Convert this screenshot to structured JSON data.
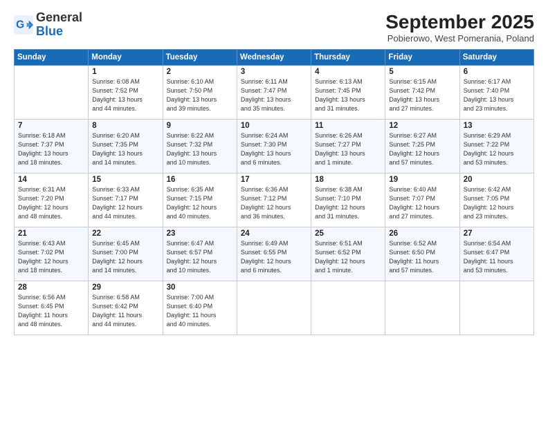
{
  "logo": {
    "general": "General",
    "blue": "Blue"
  },
  "header": {
    "month": "September 2025",
    "location": "Pobierowo, West Pomerania, Poland"
  },
  "days_of_week": [
    "Sunday",
    "Monday",
    "Tuesday",
    "Wednesday",
    "Thursday",
    "Friday",
    "Saturday"
  ],
  "weeks": [
    [
      {
        "day": "",
        "info": ""
      },
      {
        "day": "1",
        "info": "Sunrise: 6:08 AM\nSunset: 7:52 PM\nDaylight: 13 hours\nand 44 minutes."
      },
      {
        "day": "2",
        "info": "Sunrise: 6:10 AM\nSunset: 7:50 PM\nDaylight: 13 hours\nand 39 minutes."
      },
      {
        "day": "3",
        "info": "Sunrise: 6:11 AM\nSunset: 7:47 PM\nDaylight: 13 hours\nand 35 minutes."
      },
      {
        "day": "4",
        "info": "Sunrise: 6:13 AM\nSunset: 7:45 PM\nDaylight: 13 hours\nand 31 minutes."
      },
      {
        "day": "5",
        "info": "Sunrise: 6:15 AM\nSunset: 7:42 PM\nDaylight: 13 hours\nand 27 minutes."
      },
      {
        "day": "6",
        "info": "Sunrise: 6:17 AM\nSunset: 7:40 PM\nDaylight: 13 hours\nand 23 minutes."
      }
    ],
    [
      {
        "day": "7",
        "info": "Sunrise: 6:18 AM\nSunset: 7:37 PM\nDaylight: 13 hours\nand 18 minutes."
      },
      {
        "day": "8",
        "info": "Sunrise: 6:20 AM\nSunset: 7:35 PM\nDaylight: 13 hours\nand 14 minutes."
      },
      {
        "day": "9",
        "info": "Sunrise: 6:22 AM\nSunset: 7:32 PM\nDaylight: 13 hours\nand 10 minutes."
      },
      {
        "day": "10",
        "info": "Sunrise: 6:24 AM\nSunset: 7:30 PM\nDaylight: 13 hours\nand 6 minutes."
      },
      {
        "day": "11",
        "info": "Sunrise: 6:26 AM\nSunset: 7:27 PM\nDaylight: 13 hours\nand 1 minute."
      },
      {
        "day": "12",
        "info": "Sunrise: 6:27 AM\nSunset: 7:25 PM\nDaylight: 12 hours\nand 57 minutes."
      },
      {
        "day": "13",
        "info": "Sunrise: 6:29 AM\nSunset: 7:22 PM\nDaylight: 12 hours\nand 53 minutes."
      }
    ],
    [
      {
        "day": "14",
        "info": "Sunrise: 6:31 AM\nSunset: 7:20 PM\nDaylight: 12 hours\nand 48 minutes."
      },
      {
        "day": "15",
        "info": "Sunrise: 6:33 AM\nSunset: 7:17 PM\nDaylight: 12 hours\nand 44 minutes."
      },
      {
        "day": "16",
        "info": "Sunrise: 6:35 AM\nSunset: 7:15 PM\nDaylight: 12 hours\nand 40 minutes."
      },
      {
        "day": "17",
        "info": "Sunrise: 6:36 AM\nSunset: 7:12 PM\nDaylight: 12 hours\nand 36 minutes."
      },
      {
        "day": "18",
        "info": "Sunrise: 6:38 AM\nSunset: 7:10 PM\nDaylight: 12 hours\nand 31 minutes."
      },
      {
        "day": "19",
        "info": "Sunrise: 6:40 AM\nSunset: 7:07 PM\nDaylight: 12 hours\nand 27 minutes."
      },
      {
        "day": "20",
        "info": "Sunrise: 6:42 AM\nSunset: 7:05 PM\nDaylight: 12 hours\nand 23 minutes."
      }
    ],
    [
      {
        "day": "21",
        "info": "Sunrise: 6:43 AM\nSunset: 7:02 PM\nDaylight: 12 hours\nand 18 minutes."
      },
      {
        "day": "22",
        "info": "Sunrise: 6:45 AM\nSunset: 7:00 PM\nDaylight: 12 hours\nand 14 minutes."
      },
      {
        "day": "23",
        "info": "Sunrise: 6:47 AM\nSunset: 6:57 PM\nDaylight: 12 hours\nand 10 minutes."
      },
      {
        "day": "24",
        "info": "Sunrise: 6:49 AM\nSunset: 6:55 PM\nDaylight: 12 hours\nand 6 minutes."
      },
      {
        "day": "25",
        "info": "Sunrise: 6:51 AM\nSunset: 6:52 PM\nDaylight: 12 hours\nand 1 minute."
      },
      {
        "day": "26",
        "info": "Sunrise: 6:52 AM\nSunset: 6:50 PM\nDaylight: 11 hours\nand 57 minutes."
      },
      {
        "day": "27",
        "info": "Sunrise: 6:54 AM\nSunset: 6:47 PM\nDaylight: 11 hours\nand 53 minutes."
      }
    ],
    [
      {
        "day": "28",
        "info": "Sunrise: 6:56 AM\nSunset: 6:45 PM\nDaylight: 11 hours\nand 48 minutes."
      },
      {
        "day": "29",
        "info": "Sunrise: 6:58 AM\nSunset: 6:42 PM\nDaylight: 11 hours\nand 44 minutes."
      },
      {
        "day": "30",
        "info": "Sunrise: 7:00 AM\nSunset: 6:40 PM\nDaylight: 11 hours\nand 40 minutes."
      },
      {
        "day": "",
        "info": ""
      },
      {
        "day": "",
        "info": ""
      },
      {
        "day": "",
        "info": ""
      },
      {
        "day": "",
        "info": ""
      }
    ]
  ]
}
